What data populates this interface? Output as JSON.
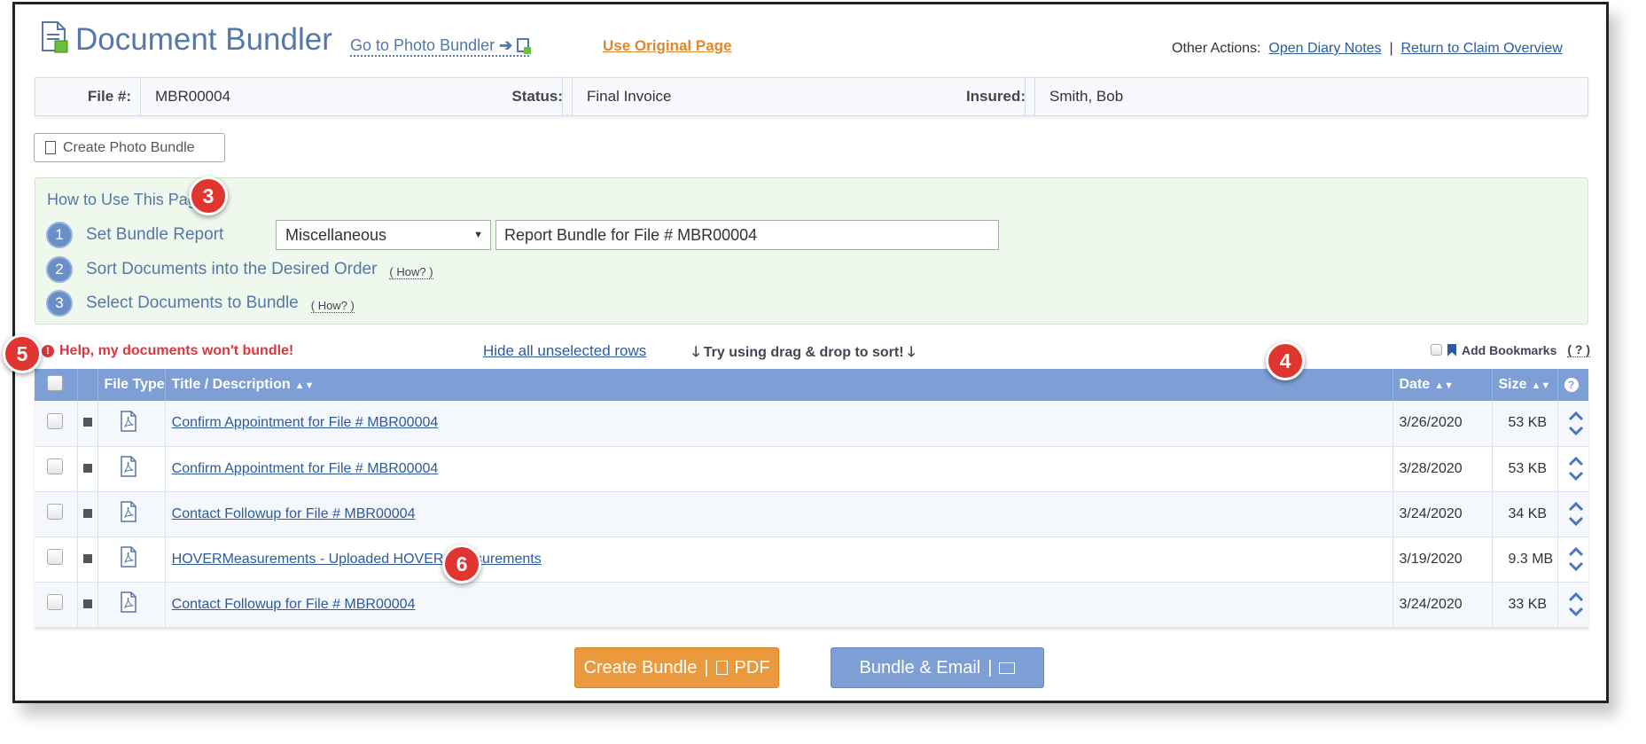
{
  "header": {
    "title": "Document Bundler",
    "photo_link": "Go to Photo Bundler",
    "original_link": "Use Original Page",
    "other_label": "Other Actions:",
    "diary_link": "Open Diary Notes",
    "separator": "|",
    "claim_link": "Return to Claim Overview"
  },
  "info": {
    "file_label": "File #:",
    "file_value": "MBR00004",
    "status_label": "Status:",
    "status_value": "Final Invoice",
    "insured_label": "Insured:",
    "insured_value": "Smith, Bob"
  },
  "photo_bundle_button": "Create Photo Bundle",
  "howto": {
    "title": "How to Use This Page",
    "steps": [
      {
        "num": "1",
        "label": "Set Bundle Report"
      },
      {
        "num": "2",
        "label": "Sort Documents into the Desired Order",
        "how": "( How? )"
      },
      {
        "num": "3",
        "label": "Select Documents to Bundle",
        "how": "( How? )"
      }
    ],
    "type_select": "Miscellaneous",
    "bundle_title": "Report Bundle for File # MBR00004"
  },
  "toolbar": {
    "help": "Help, my documents won't bundle!",
    "hide_rows": "Hide all unselected rows",
    "drag_tip": "Try using drag & drop to sort!",
    "bookmarks": "Add Bookmarks",
    "bookmarks_help": "( ? )"
  },
  "table": {
    "headers": {
      "file_type": "File Type",
      "title": "Title / Description",
      "date": "Date",
      "size": "Size",
      "help": "?"
    },
    "rows": [
      {
        "title": "Confirm Appointment for File # MBR00004",
        "date": "3/26/2020",
        "size": "53 KB"
      },
      {
        "title": "Confirm Appointment for File # MBR00004",
        "date": "3/28/2020",
        "size": "53 KB"
      },
      {
        "title": "Contact Followup for File # MBR00004",
        "date": "3/24/2020",
        "size": "34 KB"
      },
      {
        "title": "HOVERMeasurements - Uploaded HOVER Measurements",
        "date": "3/19/2020",
        "size": "9.3 MB"
      },
      {
        "title": "Contact Followup for File # MBR00004",
        "date": "3/24/2020",
        "size": "33 KB"
      }
    ]
  },
  "buttons": {
    "create": "Create Bundle",
    "create_suffix": "PDF",
    "email": "Bundle & Email",
    "divider": "|"
  },
  "callouts": {
    "b3": "3",
    "b4": "4",
    "b5": "5",
    "b6": "6"
  },
  "colors": {
    "accent_blue": "#7e9fd6",
    "orange": "#ea9a3c",
    "callout_red": "#e03530",
    "howto_green": "#eef8ec"
  }
}
